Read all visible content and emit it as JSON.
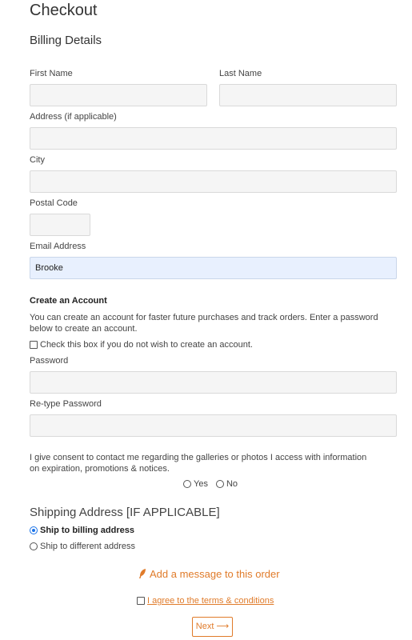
{
  "page": {
    "title": "Checkout",
    "billing_heading": "Billing Details"
  },
  "billing": {
    "first_name_label": "First Name",
    "last_name_label": "Last Name",
    "address_label": "Address (if applicable)",
    "city_label": "City",
    "postal_label": "Postal Code",
    "email_label": "Email Address",
    "email_value": "Brooke"
  },
  "account": {
    "heading": "Create an Account",
    "description": "You can create an account for faster future purchases and track orders. Enter a password below to create an account.",
    "opt_out_label": "Check this box if you do not wish to create an account.",
    "password_label": "Password",
    "retype_label": "Re-type Password"
  },
  "consent": {
    "text": "I give consent to contact me regarding the galleries or photos I access with information on expiration, promotions & notices.",
    "yes_label": "Yes",
    "no_label": "No"
  },
  "shipping": {
    "heading": "Shipping Address [IF APPLICABLE]",
    "option_billing": "Ship to billing address",
    "option_different": "Ship to different address",
    "selected": "billing"
  },
  "message": {
    "link": "Add a message to this order",
    "icon": "feather-icon"
  },
  "terms": {
    "label": "I agree to the terms & conditions"
  },
  "next_button": {
    "label": "Next ⟶"
  },
  "colors": {
    "accent": "#e07b2a",
    "field_bg": "#f5f5f5",
    "filled_bg": "#e8f0fe"
  }
}
